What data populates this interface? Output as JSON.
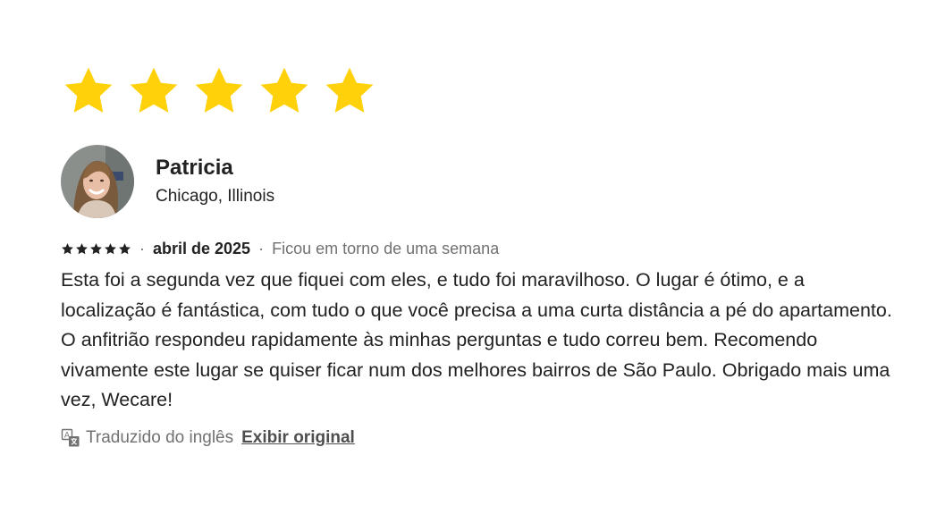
{
  "review": {
    "overall_rating": 5,
    "reviewer": {
      "name": "Patricia",
      "location": "Chicago, Illinois"
    },
    "meta": {
      "rating": 5,
      "separator": "·",
      "date": "abril de 2025",
      "stay_length": "Ficou em torno de uma semana"
    },
    "body": "Esta foi a segunda vez que fiquei com eles, e tudo foi maravilhoso. O lugar é ótimo, e a localização é fantástica, com tudo o que você precisa a uma curta distância a pé do apartamento. O anfitrião respondeu rapidamente às minhas perguntas e tudo correu bem. Recomendo vivamente este lugar se quiser ficar num dos melhores bairros de São Paulo. Obrigado mais uma vez, Wecare!",
    "translation": {
      "icon": "translate-icon",
      "label": "Traduzido do inglês",
      "show_original": "Exibir original"
    }
  },
  "colors": {
    "star_big": "#FFD10A",
    "star_small": "#222222",
    "text_primary": "#222222",
    "text_secondary": "#717171"
  }
}
